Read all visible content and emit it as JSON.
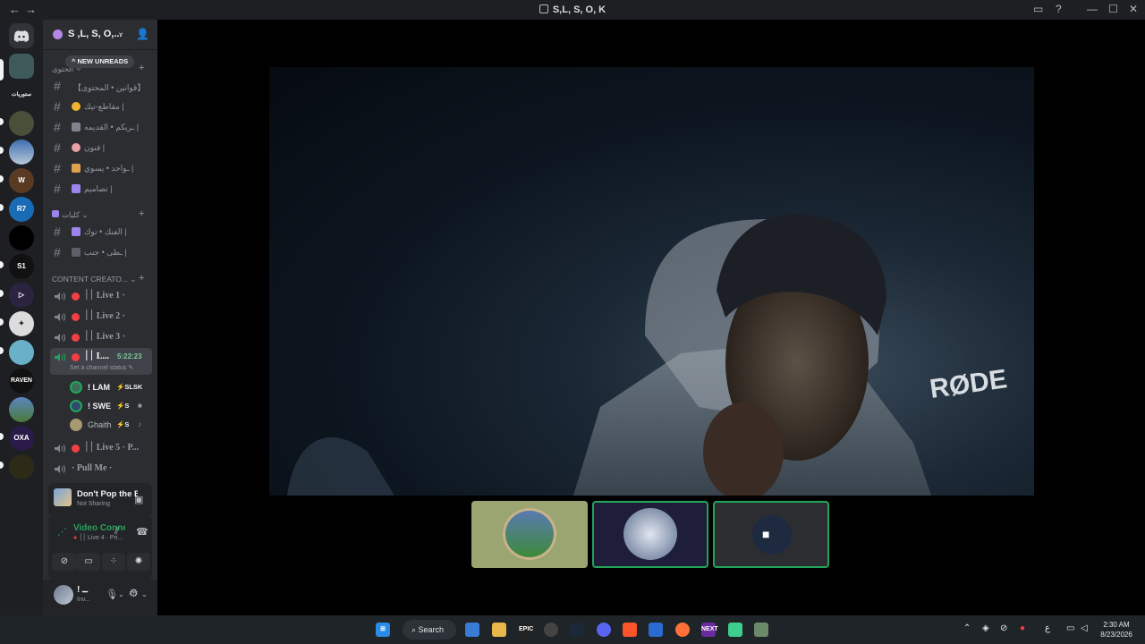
{
  "window": {
    "title": "S,L, S, O, K",
    "back_icon": "arrow-left-icon",
    "forward_icon": "arrow-right-icon",
    "controls": [
      "inbox-icon",
      "help-icon",
      "minimize-icon",
      "maximize-icon",
      "close-icon"
    ]
  },
  "guild": {
    "name": "S ,L, S, O,...",
    "new_unreads": "NEW UNREADS",
    "categories": [
      {
        "label": "الحتوى ✧"
      },
      {
        "label": "كلبات"
      },
      {
        "label": "CONTENT CREATO..."
      }
    ],
    "text_channels": [
      {
        "label": "【قوانين • المحتوى】"
      },
      {
        "label": "مقاطع-تيك |"
      },
      {
        "label": "ـريكم • القديمه |"
      },
      {
        "label": "فنون |"
      },
      {
        "label": "ـواحد • يسوي |"
      },
      {
        "label": "تصاميم |"
      },
      {
        "label": "الفنك • توك |"
      },
      {
        "label": "ـطى • جنب |"
      }
    ],
    "voice_channels": [
      {
        "label": "׀׀ Live 1 ·"
      },
      {
        "label": "׀׀ Live 2 ·"
      },
      {
        "label": "׀׀ Live 3 ·"
      },
      {
        "label": "׀׀ L...",
        "timer": "5:22:23",
        "status_hint": "Set a channel status"
      },
      {
        "label": "׀׀ Live 5 · P..."
      },
      {
        "label": "· Pull Me ·"
      }
    ],
    "voice_users": [
      {
        "name": "! LAM",
        "tag": "⚡SLSK"
      },
      {
        "name": "! SWE",
        "tag": "⚡S"
      },
      {
        "name": "Ghaith",
        "tag": "⚡S"
      }
    ]
  },
  "activity": {
    "title": "Don't Pop the Ballo...",
    "subtitle": "Not Sharing"
  },
  "voice": {
    "status": "Video Connected",
    "channel": "׀׀ Live 4 · Pri..."
  },
  "user": {
    "name": "! ــ",
    "status": "Inv..."
  },
  "video": {
    "overlay_text": "RØDE"
  },
  "taskbar": {
    "search_label": "Search",
    "lang": "ع",
    "time": "2:30 AM",
    "date": "8/23/2026"
  },
  "colors": {
    "sidebar_bg": "#2b2d31",
    "rail_bg": "#1e1f22",
    "live_dot": "#f23f43",
    "speaking_green": "#23a559"
  }
}
